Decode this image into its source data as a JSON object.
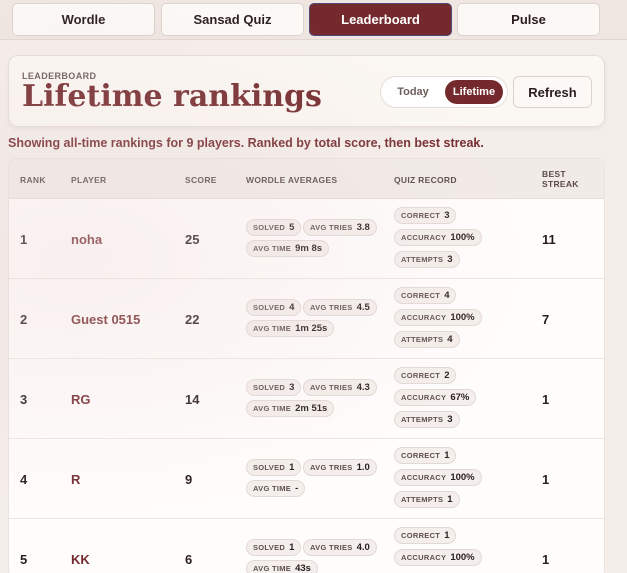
{
  "nav": {
    "tabs": [
      {
        "label": "Wordle"
      },
      {
        "label": "Sansad Quiz"
      },
      {
        "label": "Leaderboard"
      },
      {
        "label": "Pulse"
      }
    ]
  },
  "hero": {
    "eyebrow": "LEADERBOARD",
    "title": "Lifetime rankings",
    "toggle": {
      "today": "Today",
      "lifetime": "Lifetime"
    },
    "refresh_label": "Refresh"
  },
  "summary": "Showing all-time rankings for 9 players. Ranked by total score, then best streak.",
  "table": {
    "headers": {
      "rank": "RANK",
      "player": "PLAYER",
      "score": "SCORE",
      "wordle": "WORDLE AVERAGES",
      "quiz": "QUIZ RECORD",
      "streak_1": "BEST",
      "streak_2": "STREAK"
    },
    "labels": {
      "solved": "SOLVED",
      "avg_tries": "AVG TRIES",
      "avg_time": "AVG TIME",
      "correct": "CORRECT",
      "accuracy": "ACCURACY",
      "attempts": "ATTEMPTS"
    },
    "rows": [
      {
        "rank": "1",
        "player": "noha",
        "score": "25",
        "solved": "5",
        "avg_tries": "3.8",
        "avg_time": "9m 8s",
        "correct": "3",
        "accuracy": "100%",
        "attempts": "3",
        "streak": "11"
      },
      {
        "rank": "2",
        "player": "Guest 0515",
        "score": "22",
        "solved": "4",
        "avg_tries": "4.5",
        "avg_time": "1m 25s",
        "correct": "4",
        "accuracy": "100%",
        "attempts": "4",
        "streak": "7"
      },
      {
        "rank": "3",
        "player": "RG",
        "score": "14",
        "solved": "3",
        "avg_tries": "4.3",
        "avg_time": "2m 51s",
        "correct": "2",
        "accuracy": "67%",
        "attempts": "3",
        "streak": "1"
      },
      {
        "rank": "4",
        "player": "R",
        "score": "9",
        "solved": "1",
        "avg_tries": "1.0",
        "avg_time": "-",
        "correct": "1",
        "accuracy": "100%",
        "attempts": "1",
        "streak": "1"
      },
      {
        "rank": "5",
        "player": "KK",
        "score": "6",
        "solved": "1",
        "avg_tries": "4.0",
        "avg_time": "43s",
        "correct": "1",
        "accuracy": "100%",
        "attempts": "",
        "streak": "1"
      }
    ]
  },
  "colors": {
    "accent": "#742a2d",
    "background": "#f4eeea"
  }
}
